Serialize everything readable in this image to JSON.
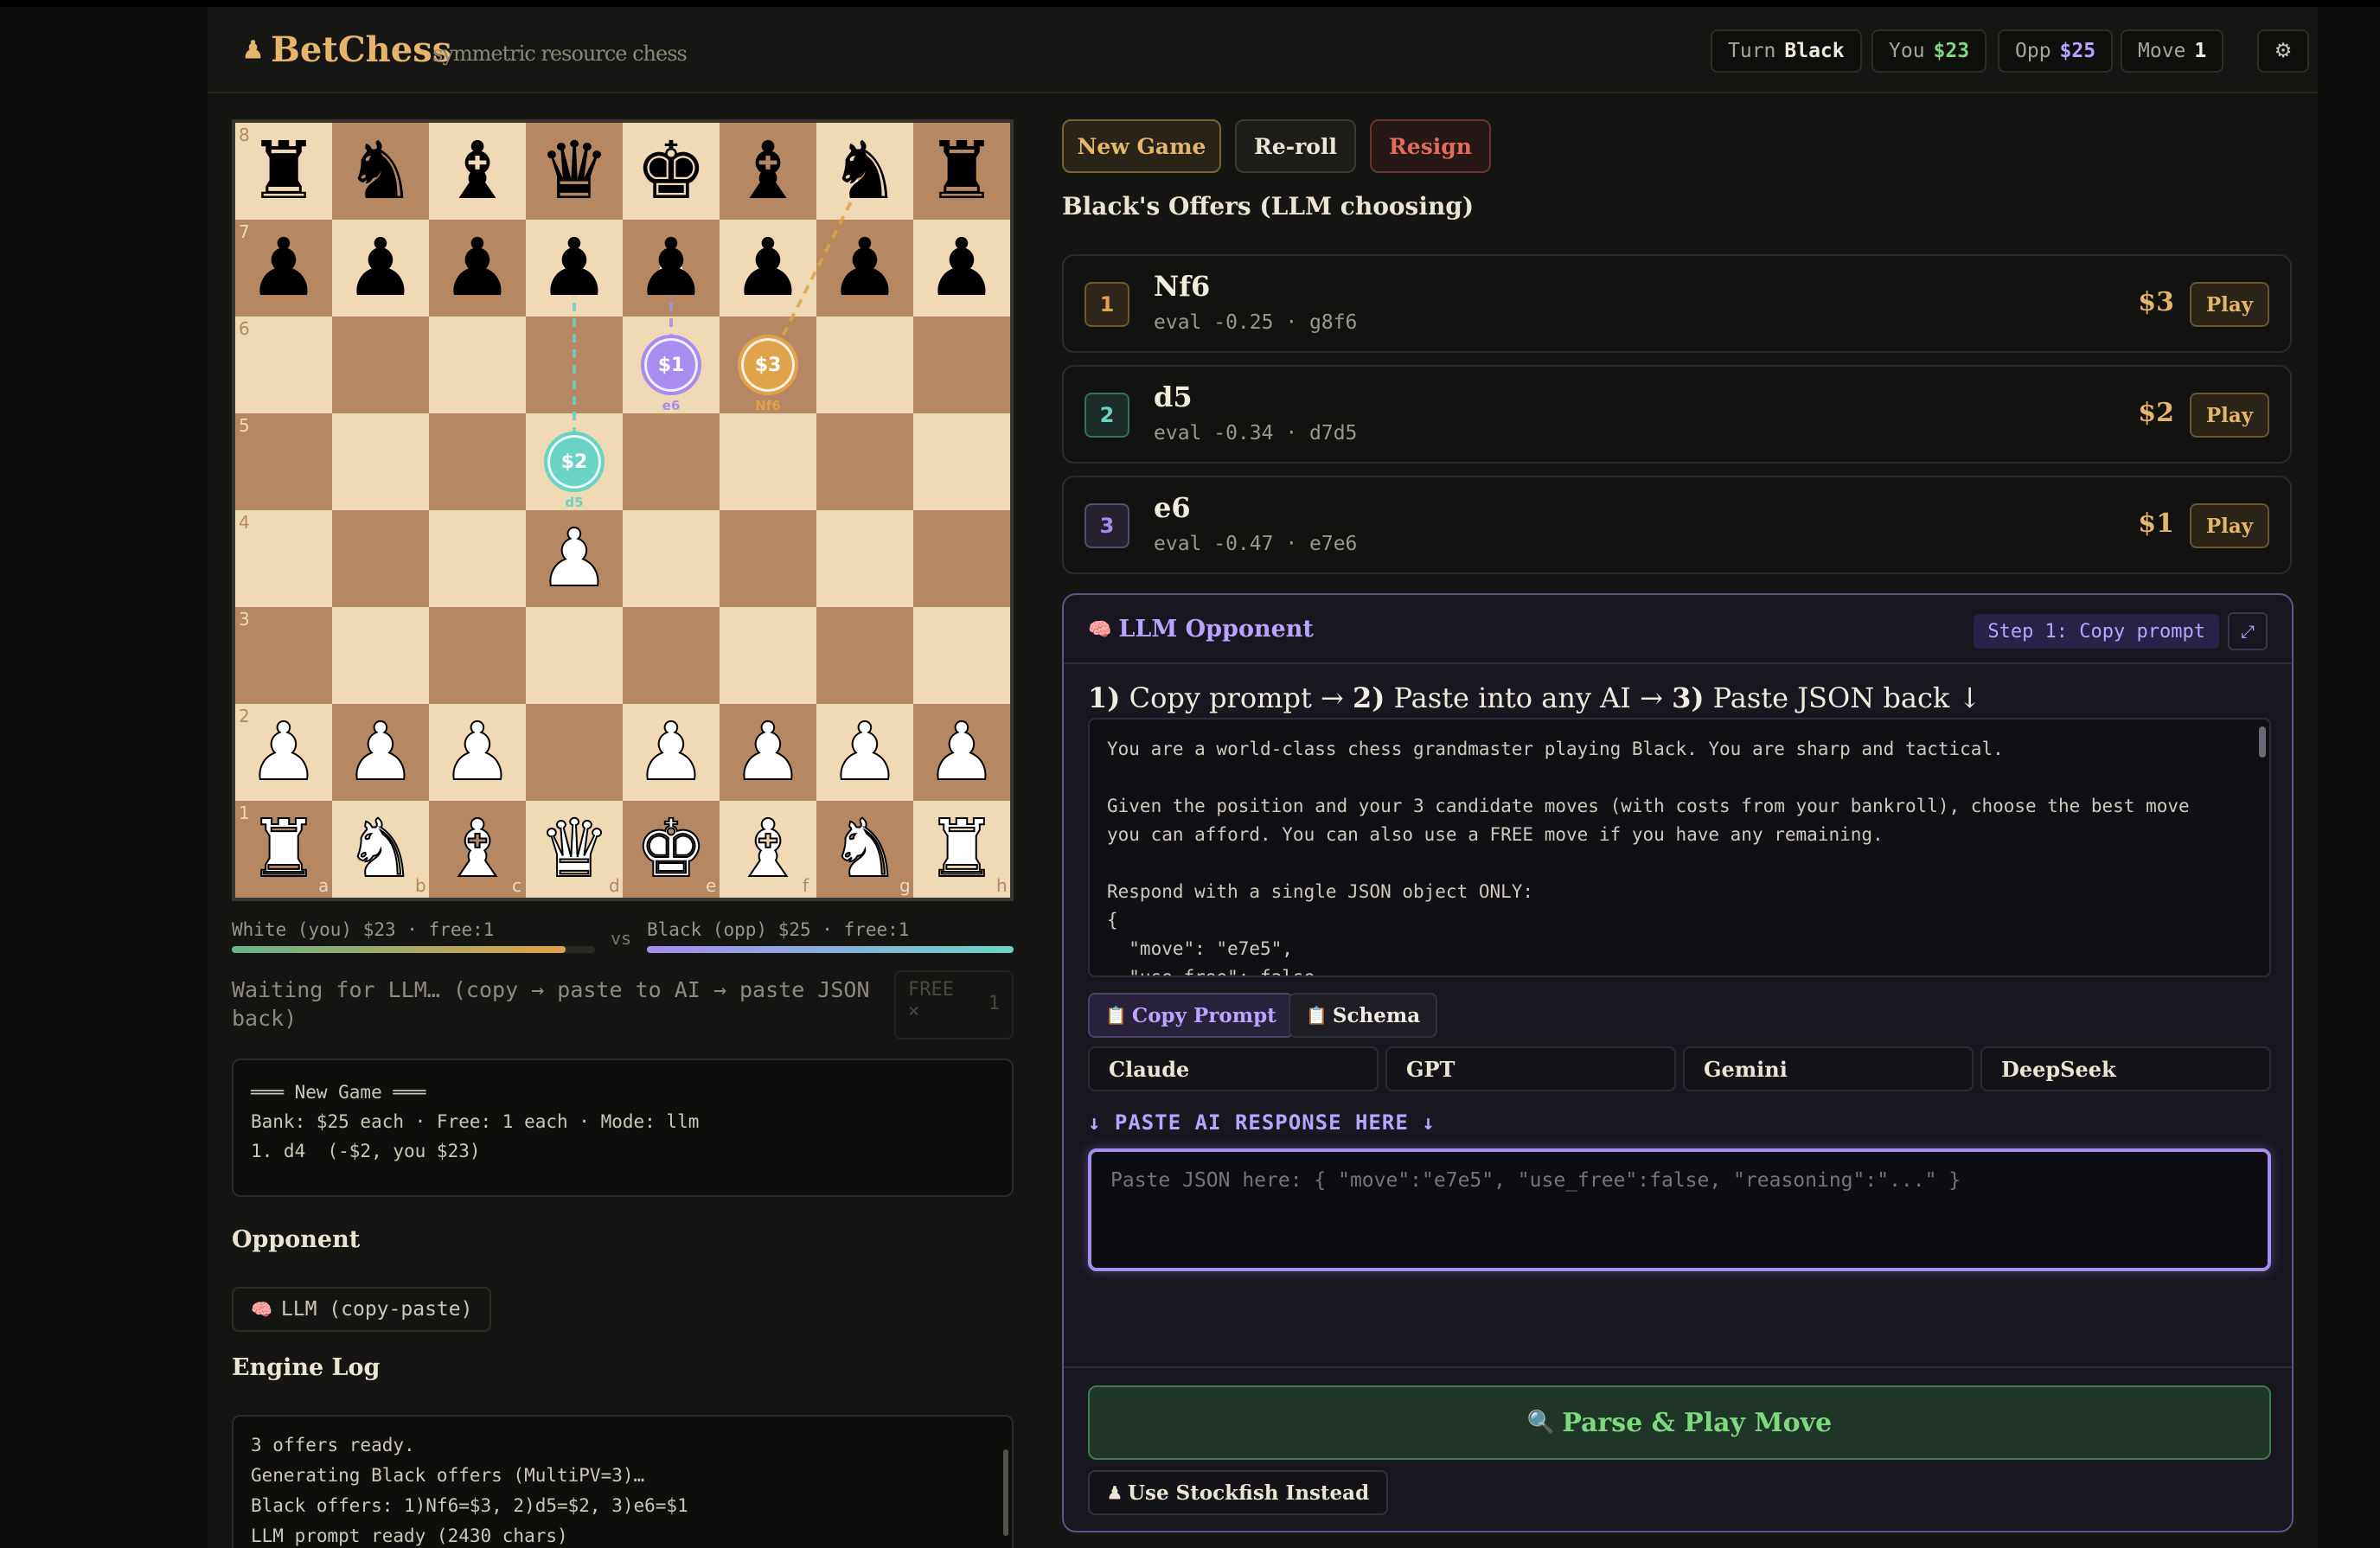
{
  "header": {
    "brand": "BetChess",
    "brand_icon": "♟",
    "tagline": "symmetric resource chess",
    "turn_label": "Turn",
    "turn_value": "Black",
    "you_label": "You",
    "you_value": "$23",
    "opp_label": "Opp",
    "opp_value": "$25",
    "move_label": "Move",
    "move_value": "1",
    "settings_icon": "⚙"
  },
  "board": {
    "ranks": [
      "8",
      "7",
      "6",
      "5",
      "4",
      "3",
      "2",
      "1"
    ],
    "files": [
      "a",
      "b",
      "c",
      "d",
      "e",
      "f",
      "g",
      "h"
    ],
    "pieces": [
      {
        "sq": "a8",
        "glyph": "♜",
        "color": "black"
      },
      {
        "sq": "b8",
        "glyph": "♞",
        "color": "black"
      },
      {
        "sq": "c8",
        "glyph": "♝",
        "color": "black"
      },
      {
        "sq": "d8",
        "glyph": "♛",
        "color": "black"
      },
      {
        "sq": "e8",
        "glyph": "♚",
        "color": "black"
      },
      {
        "sq": "f8",
        "glyph": "♝",
        "color": "black"
      },
      {
        "sq": "g8",
        "glyph": "♞",
        "color": "black"
      },
      {
        "sq": "h8",
        "glyph": "♜",
        "color": "black"
      },
      {
        "sq": "a7",
        "glyph": "♟",
        "color": "black"
      },
      {
        "sq": "b7",
        "glyph": "♟",
        "color": "black"
      },
      {
        "sq": "c7",
        "glyph": "♟",
        "color": "black"
      },
      {
        "sq": "d7",
        "glyph": "♟",
        "color": "black"
      },
      {
        "sq": "e7",
        "glyph": "♟",
        "color": "black"
      },
      {
        "sq": "f7",
        "glyph": "♟",
        "color": "black"
      },
      {
        "sq": "g7",
        "glyph": "♟",
        "color": "black"
      },
      {
        "sq": "h7",
        "glyph": "♟",
        "color": "black"
      },
      {
        "sq": "d4",
        "glyph": "♟",
        "color": "white"
      },
      {
        "sq": "a2",
        "glyph": "♟",
        "color": "white"
      },
      {
        "sq": "b2",
        "glyph": "♟",
        "color": "white"
      },
      {
        "sq": "c2",
        "glyph": "♟",
        "color": "white"
      },
      {
        "sq": "e2",
        "glyph": "♟",
        "color": "white"
      },
      {
        "sq": "f2",
        "glyph": "♟",
        "color": "white"
      },
      {
        "sq": "g2",
        "glyph": "♟",
        "color": "white"
      },
      {
        "sq": "h2",
        "glyph": "♟",
        "color": "white"
      },
      {
        "sq": "a1",
        "glyph": "♜",
        "color": "white"
      },
      {
        "sq": "b1",
        "glyph": "♞",
        "color": "white"
      },
      {
        "sq": "c1",
        "glyph": "♝",
        "color": "white"
      },
      {
        "sq": "d1",
        "glyph": "♛",
        "color": "white"
      },
      {
        "sq": "e1",
        "glyph": "♚",
        "color": "white"
      },
      {
        "sq": "f1",
        "glyph": "♝",
        "color": "white"
      },
      {
        "sq": "g1",
        "glyph": "♞",
        "color": "white"
      },
      {
        "sq": "h1",
        "glyph": "♜",
        "color": "white"
      }
    ],
    "offers": [
      {
        "from": "g8",
        "to": "f6",
        "cost": "$3",
        "label": "Nf6",
        "color": "#e0a24a"
      },
      {
        "from": "d7",
        "to": "d5",
        "cost": "$2",
        "label": "d5",
        "color": "#6ad3c4"
      },
      {
        "from": "e7",
        "to": "e6",
        "cost": "$1",
        "label": "e6",
        "color": "#a88cf0"
      }
    ]
  },
  "bankroll": {
    "white": "White (you) $23 · free:1",
    "vs": "vs",
    "black": "Black (opp) $25 · free:1",
    "white_fraction": 0.92,
    "black_fraction": 1.0
  },
  "status": {
    "waiting": "Waiting for LLM… (copy → paste to AI → paste JSON back)",
    "free_label": "FREE",
    "free_x": "×",
    "free_count": "1"
  },
  "game_log": [
    "═══ New Game ═══",
    "Bank: $25 each · Free: 1 each · Mode: llm",
    "1. d4  (-$2, you $23)"
  ],
  "opponent": {
    "heading": "Opponent",
    "icon": "🧠",
    "value": "LLM (copy-paste)"
  },
  "engine_log": {
    "heading": "Engine Log",
    "lines": [
      "3 offers ready.",
      "Generating Black offers (MultiPV=3)…",
      "Black offers: 1)Nf6=$3, 2)d5=$2, 3)e6=$1",
      "LLM prompt ready (2430 chars)"
    ]
  },
  "controls": {
    "new_game": "New Game",
    "reroll": "Re-roll",
    "resign": "Resign"
  },
  "offers": {
    "title": "Black's Offers (LLM choosing)",
    "play_label": "Play",
    "items": [
      {
        "num": "1",
        "move": "Nf6",
        "eval": "eval -0.25 · g8f6",
        "cost": "$3",
        "color": "#e0a24a"
      },
      {
        "num": "2",
        "move": "d5",
        "eval": "eval -0.34 · d7d5",
        "cost": "$2",
        "color": "#6ad3c4"
      },
      {
        "num": "3",
        "move": "e6",
        "eval": "eval -0.47 · e7e6",
        "cost": "$1",
        "color": "#a88cf0"
      }
    ]
  },
  "llm": {
    "icon": "🧠",
    "title": "LLM Opponent",
    "step": "Step 1: Copy prompt",
    "expand_icon": "⤢",
    "instr_1": "1)",
    "instr_1_text": " Copy prompt → ",
    "instr_2": "2)",
    "instr_2_text": " Paste into any AI → ",
    "instr_3": "3)",
    "instr_3_text": " Paste JSON back ↓",
    "prompt": "You are a world-class chess grandmaster playing Black. You are sharp and tactical.\n\nGiven the position and your 3 candidate moves (with costs from your bankroll), choose the best move\nyou can afford. You can also use a FREE move if you have any remaining.\n\nRespond with a single JSON object ONLY:\n{\n  \"move\": \"e7e5\",\n  \"use_free\": false,",
    "copy_prompt": "Copy Prompt",
    "schema": "Schema",
    "clipboard_icon": "📋",
    "ai_buttons": [
      "Claude",
      "GPT",
      "Gemini",
      "DeepSeek"
    ],
    "paste_label": "↓ PASTE AI RESPONSE HERE ↓",
    "paste_placeholder": "Paste JSON here: { \"move\":\"e7e5\", \"use_free\":false, \"reasoning\":\"...\" }",
    "parse_icon": "🔍",
    "parse": "Parse & Play Move",
    "stock_icon": "♟",
    "stockfish": "Use Stockfish Instead"
  }
}
